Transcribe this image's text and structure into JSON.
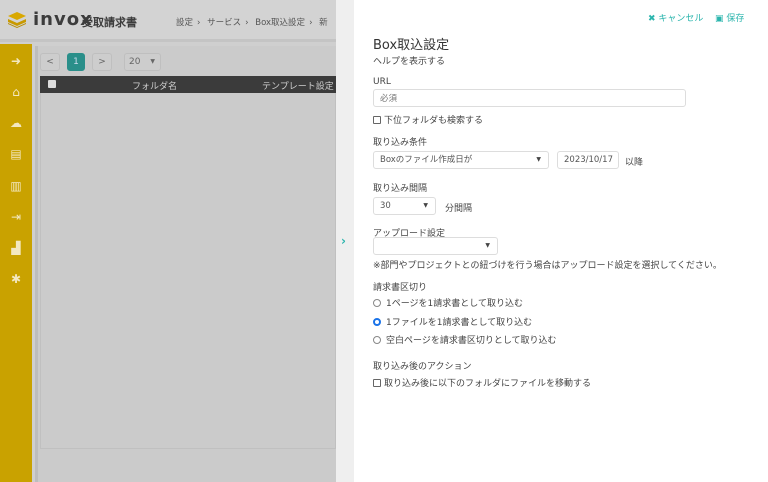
{
  "header": {
    "brand": "invox",
    "brand_sub": "受取請求書",
    "breadcrumb": [
      "設定",
      "サービス",
      "Box取込設定",
      "新"
    ]
  },
  "sidebar": {
    "icons": [
      "arrow-circle-right-icon",
      "home-icon",
      "cloud-upload-icon",
      "document-icon",
      "building-icon",
      "file-export-icon",
      "chart-icon",
      "gear-icon"
    ]
  },
  "list": {
    "page": "1",
    "prev": "<",
    "next": ">",
    "page_size": "20",
    "columns": [
      "フォルダ名",
      "テンプレート設定"
    ]
  },
  "panel": {
    "cancel": "キャンセル",
    "save": "保存",
    "title": "Box取込設定",
    "help": "ヘルプを表示する",
    "url_label": "URL",
    "url_placeholder": "必須",
    "url_value": "",
    "subfolder_label": "下位フォルダも検索する",
    "condition_label": "取り込み条件",
    "condition_select": "Boxのファイル作成日が",
    "condition_date": "2023/10/17",
    "condition_suffix": "以降",
    "interval_label": "取り込み間隔",
    "interval_value": "30",
    "interval_suffix": "分間隔",
    "upload_label": "アップロード設定",
    "upload_value": "",
    "upload_note": "※部門やプロジェクトとの紐づけを行う場合はアップロード設定を選択してください。",
    "split_label": "請求書区切り",
    "split_options": [
      "1ページを1請求書として取り込む",
      "1ファイルを1請求書として取り込む",
      "空白ページを請求書区切りとして取り込む"
    ],
    "split_selected": 1,
    "action_label": "取り込み後のアクション",
    "action_checkbox": "取り込み後に以下のフォルダにファイルを移動する"
  },
  "colors": {
    "accent": "#2bb5ad",
    "sidebar": "#c9a200",
    "radio": "#1a73e8"
  }
}
